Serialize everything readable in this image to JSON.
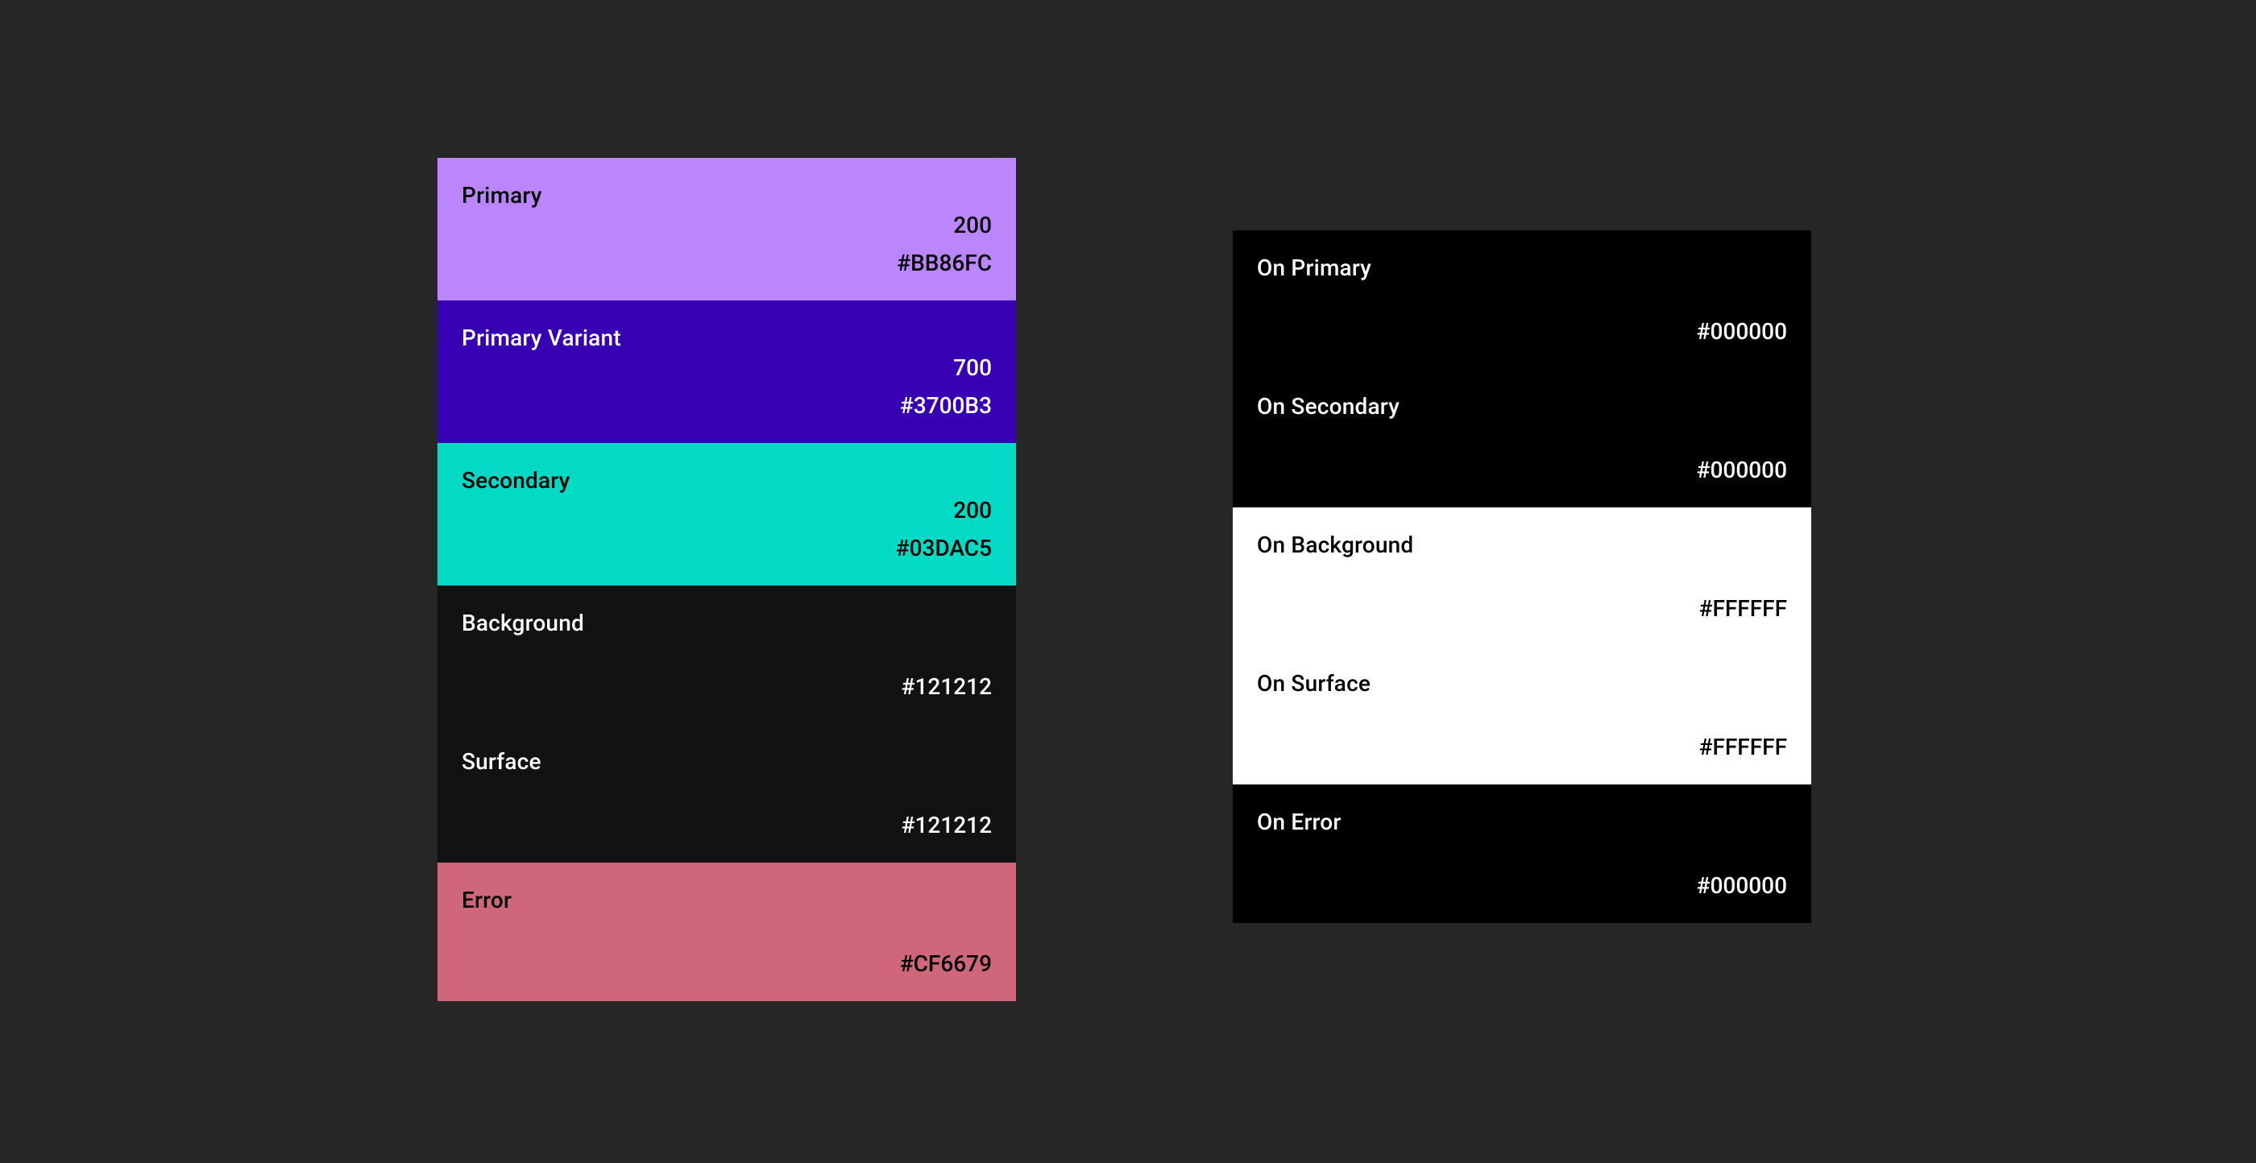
{
  "leftPalette": [
    {
      "label": "Primary",
      "shade": "200",
      "hex": "#BB86FC",
      "bg": "#BB86FC",
      "text": "dark"
    },
    {
      "label": "Primary Variant",
      "shade": "700",
      "hex": "#3700B3",
      "bg": "#3700B3",
      "text": "light"
    },
    {
      "label": "Secondary",
      "shade": "200",
      "hex": "#03DAC5",
      "bg": "#03DAC5",
      "text": "dark"
    },
    {
      "label": "Background",
      "shade": "",
      "hex": "#121212",
      "bg": "#121212",
      "text": "light"
    },
    {
      "label": "Surface",
      "shade": "",
      "hex": "#121212",
      "bg": "#121212",
      "text": "light"
    },
    {
      "label": "Error",
      "shade": "",
      "hex": "#CF6679",
      "bg": "#CF6679",
      "text": "dark"
    }
  ],
  "rightPalette": [
    {
      "label": "On Primary",
      "shade": "",
      "hex": "#000000",
      "bg": "#000000",
      "text": "light"
    },
    {
      "label": "On Secondary",
      "shade": "",
      "hex": "#000000",
      "bg": "#000000",
      "text": "light"
    },
    {
      "label": "On Background",
      "shade": "",
      "hex": "#FFFFFF",
      "bg": "#FFFFFF",
      "text": "dark"
    },
    {
      "label": "On Surface",
      "shade": "",
      "hex": "#FFFFFF",
      "bg": "#FFFFFF",
      "text": "dark"
    },
    {
      "label": "On Error",
      "shade": "",
      "hex": "#000000",
      "bg": "#000000",
      "text": "light"
    }
  ]
}
